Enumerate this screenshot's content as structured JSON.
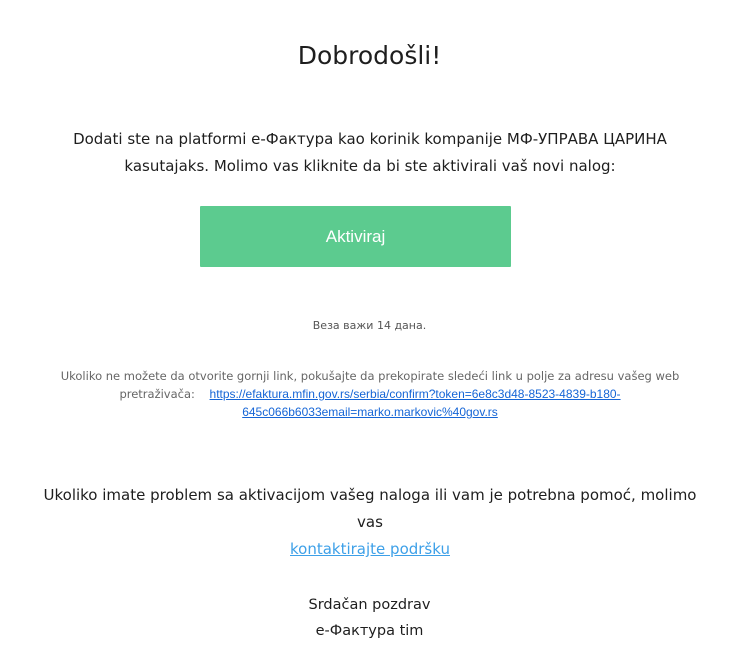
{
  "email": {
    "title": "Dobrodošli!",
    "intro_text": "Dodati ste na platformi e-Фактура kao korinik kompanije МФ-УПРАВА ЦАРИНА kasutajaks. Molimo vas kliknite da bi ste aktivirali vaš novi nalog:",
    "activate_button_label": "Aktiviraj",
    "validity_text": "Веза важи 14 дана.",
    "fallback_text": "Ukoliko ne možete da otvorite gornji link, pokušajte da prekopirate sledeći link u polje za adresu vašeg web pretraživača:",
    "fallback_link": "https://efaktura.mfin.gov.rs/serbia/confirm?token=6e8c3d48-8523-4839-b180-645c066b6033email=marko.markovic%40gov.rs",
    "support_text": "Ukoliko imate problem sa aktivacijom vašeg naloga ili vam je potrebna pomoć, molimo vas",
    "support_link_label": "kontaktirajte podršku",
    "signoff_line1": "Srdačan pozdrav",
    "signoff_line2": "e-Фактура tim"
  },
  "colors": {
    "button_background": "#5ccb8f",
    "link_blue": "#1565d6",
    "support_link_blue": "#3da0e8"
  }
}
